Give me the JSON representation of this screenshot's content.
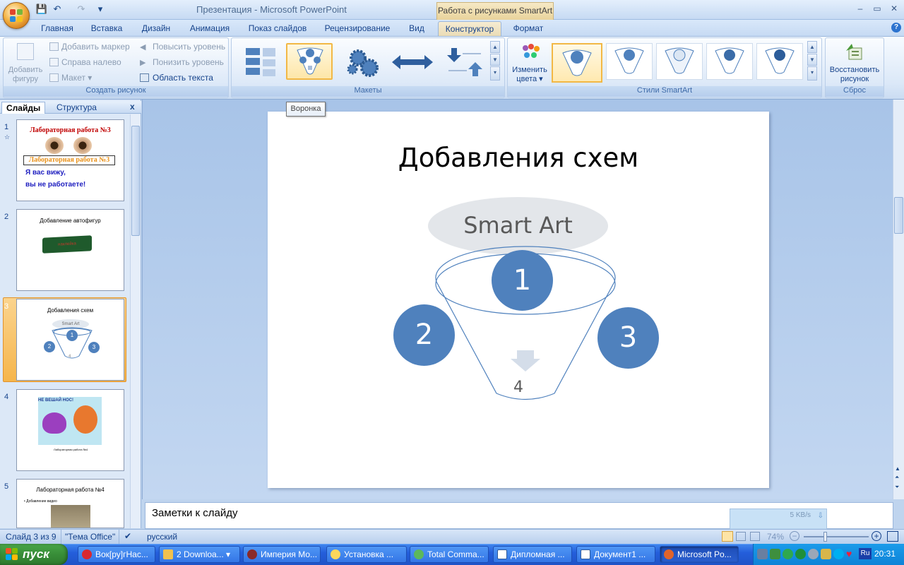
{
  "window": {
    "title": "Презентация - Microsoft PowerPoint",
    "context_tab_header": "Работа с рисунками SmartArt",
    "minimize": "‒",
    "maximize": "▭",
    "close": "✕"
  },
  "qat": {
    "save": "💾",
    "undo": "↶",
    "redo": "↷",
    "customize": "▾"
  },
  "tabs": [
    "Главная",
    "Вставка",
    "Дизайн",
    "Анимация",
    "Показ слайдов",
    "Рецензирование",
    "Вид",
    "Конструктор",
    "Формат"
  ],
  "ribbon": {
    "create_group": {
      "label": "Создать рисунок",
      "add_shape": "Добавить фигуру",
      "add_bullet": "Добавить маркер",
      "right_to_left": "Справа налево",
      "layout": "Макет",
      "promote": "Повысить уровень",
      "demote": "Понизить уровень",
      "text_pane": "Область текста"
    },
    "layouts_group": {
      "label": "Макеты"
    },
    "styles_group": {
      "label": "Стили SmartArt",
      "change_colors": "Изменить цвета"
    },
    "reset_group": {
      "label": "Сброс",
      "reset_graphic": "Восстановить рисунок"
    }
  },
  "tooltip": "Воронка",
  "left_pane": {
    "tabs": [
      "Слайды",
      "Структура"
    ],
    "close": "x",
    "thumbnails": [
      {
        "num": "1",
        "title": "Лабораторная работа №3",
        "subtitle": "Лабораторная работа №3",
        "text1": "Я вас вижу,",
        "text2": "вы не работаете!"
      },
      {
        "num": "2",
        "title": "Добавление автофигур",
        "shape_text": "наклейка"
      },
      {
        "num": "3",
        "title": "Добавления схем",
        "smartart": "Smart Art",
        "items": [
          "1",
          "2",
          "3",
          "4"
        ]
      },
      {
        "num": "4",
        "title": "НЕ ВЕШАЙ НОС!",
        "caption": "Лабораторная работа №4"
      },
      {
        "num": "5",
        "title": "Лабораторная работа №4",
        "bullet": "Добавление видео"
      }
    ]
  },
  "slide": {
    "title": "Добавления схем",
    "smartart_label": "Smart Art",
    "funnel_items": [
      "1",
      "2",
      "3"
    ],
    "funnel_result": "4"
  },
  "notes_placeholder": "Заметки к слайду",
  "status": {
    "slide_of": "Слайд 3 из 9",
    "theme": "\"Тема Office\"",
    "language": "русский",
    "zoom": "74%"
  },
  "download_widget": {
    "speed": "5 KB/s"
  },
  "taskbar": {
    "start": "пуск",
    "items": [
      "Вок[ру]гНас...",
      "2 Downloa...",
      "Империя Мо...",
      "Установка ...",
      "Total Comma...",
      "Дипломная ...",
      "Документ1 ...",
      "Microsoft Po..."
    ],
    "clock": "20:31",
    "lang": "Ru"
  },
  "colors": {
    "accent_blue": "#4f81bd",
    "selection_orange": "#f2b845",
    "ribbon_text": "#15428b"
  }
}
